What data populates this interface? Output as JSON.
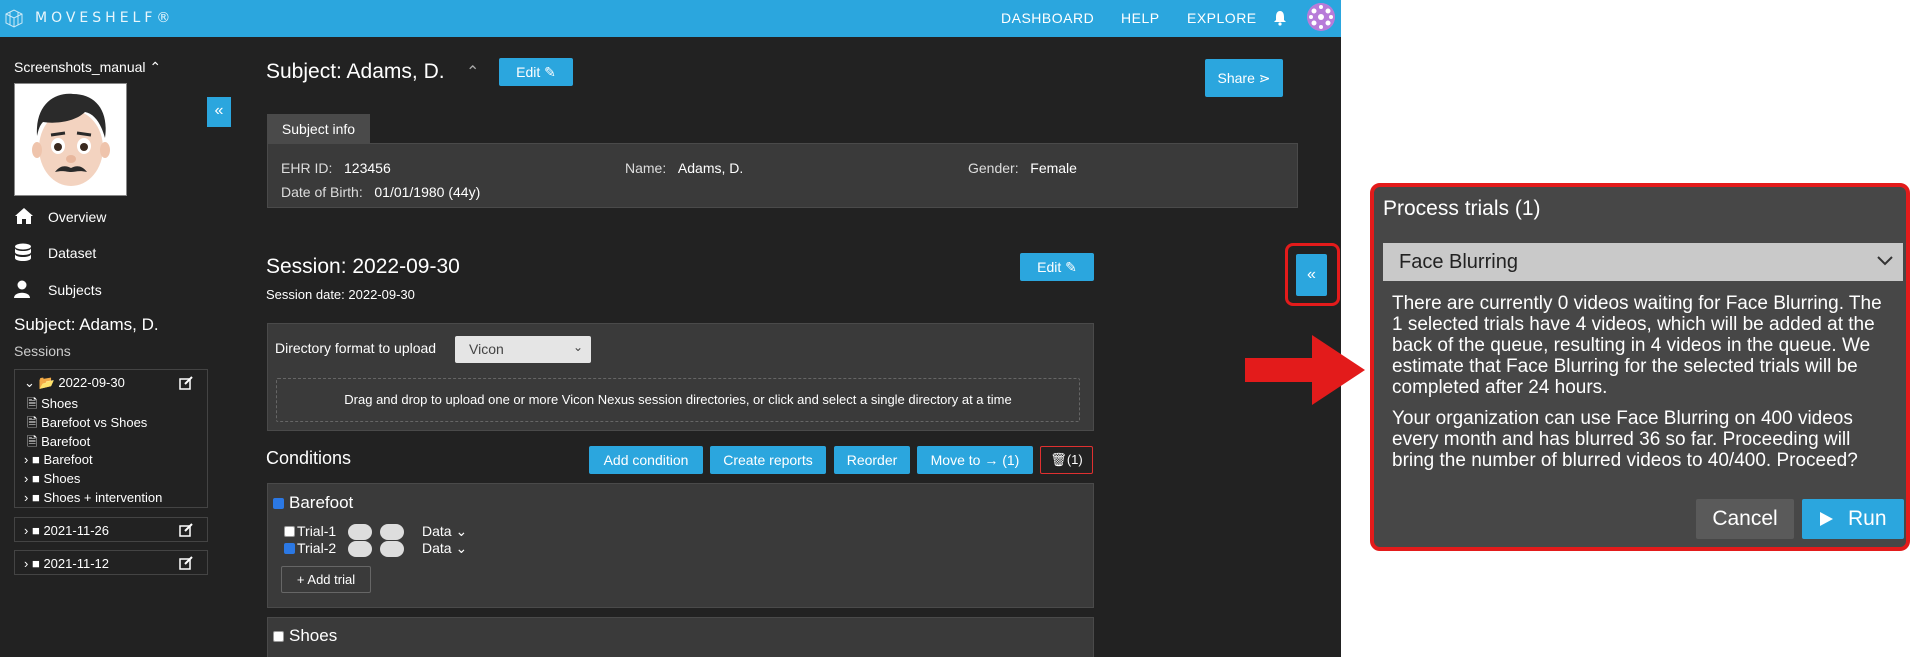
{
  "topbar": {
    "brand": "MOVESHELF®",
    "nav": [
      "DASHBOARD",
      "HELP",
      "EXPLORE"
    ]
  },
  "sidebar": {
    "project": "Screenshots_manual",
    "nav": [
      {
        "label": "Overview",
        "icon": "home-icon"
      },
      {
        "label": "Dataset",
        "icon": "database-icon"
      },
      {
        "label": "Subjects",
        "icon": "user-icon"
      }
    ],
    "subject_heading": "Subject: Adams, D.",
    "sessions_label": "Sessions",
    "sessions": [
      {
        "date": "2022-09-30",
        "expanded": true,
        "items": [
          "Shoes",
          "Barefoot vs Shoes",
          "Barefoot"
        ],
        "folders": [
          "Barefoot",
          "Shoes",
          "Shoes + intervention"
        ]
      },
      {
        "date": "2021-11-26",
        "expanded": false
      },
      {
        "date": "2021-11-12",
        "expanded": false
      }
    ],
    "collapse_symbol": "«"
  },
  "subject": {
    "title": "Subject: Adams, D.",
    "edit_label": "Edit",
    "share_label": "Share",
    "tab_label": "Subject info",
    "ehr_label": "EHR ID:",
    "ehr_value": "123456",
    "name_label": "Name:",
    "name_value": "Adams, D.",
    "gender_label": "Gender:",
    "gender_value": "Female",
    "dob_label": "Date of Birth:",
    "dob_value": "01/01/1980 (44y)"
  },
  "session": {
    "title": "Session: 2022-09-30",
    "date_line": "Session date: 2022-09-30",
    "edit_label": "Edit",
    "dir_label": "Directory format to upload",
    "dir_value": "Vicon",
    "drop_text": "Drag and drop to upload one or more Vicon Nexus session directories, or click and select a single directory at a time",
    "conditions_label": "Conditions",
    "actions": [
      "Add condition",
      "Create reports",
      "Reorder",
      "Move to → (1)"
    ],
    "delete_label": "(1)",
    "conditions": [
      {
        "name": "Barefoot",
        "checked": true,
        "trials": [
          {
            "name": "Trial-1",
            "checked": false,
            "data_label": "Data"
          },
          {
            "name": "Trial-2",
            "checked": true,
            "data_label": "Data"
          }
        ],
        "add_trial_label": "+ Add trial"
      },
      {
        "name": "Shoes",
        "checked": false
      }
    ]
  },
  "process_dialog": {
    "title": "Process trials (1)",
    "selected_process": "Face Blurring",
    "paragraph1": "There are currently 0 videos waiting for Face Blurring. The 1 selected trials have 4 videos, which will be added at the back of the queue, resulting in 4 videos in the queue. We estimate that Face Blurring for the selected trials will be completed after 24 hours.",
    "paragraph2": "Your organization can use Face Blurring on 400 videos every month and has blurred 36 so far. Proceeding will bring the number of blurred videos to 40/400. Proceed?",
    "cancel_label": "Cancel",
    "run_label": "Run"
  },
  "colors": {
    "accent": "#2ba6de",
    "background": "#222222",
    "annotation_red": "#e31b1b"
  }
}
